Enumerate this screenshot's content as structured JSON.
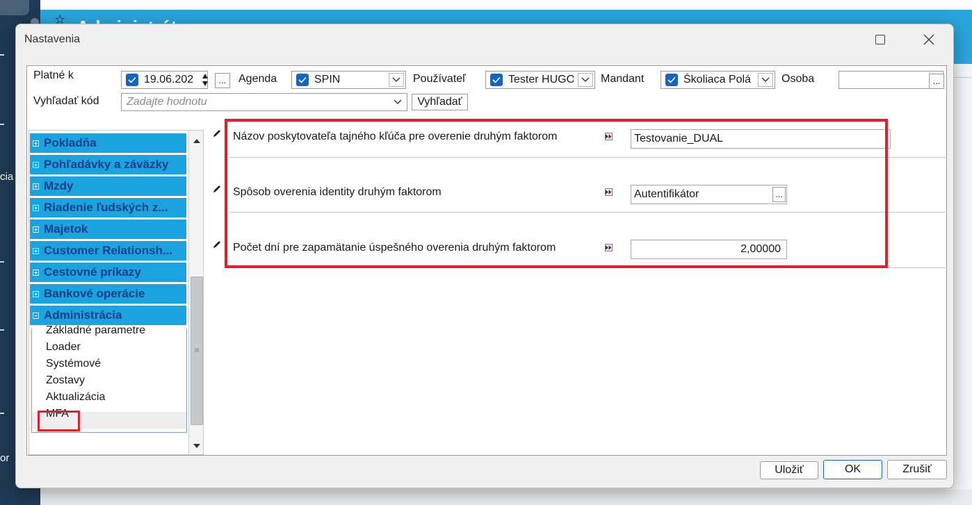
{
  "background": {
    "title": "Administrát",
    "side_labels": [
      "cia",
      "or"
    ]
  },
  "dialog": {
    "title": "Nastavenia",
    "filters": {
      "valid_label": "Platné k",
      "valid_value": "19.06.202",
      "agenda_label": "Agenda",
      "agenda_value": "SPIN",
      "user_label": "Používateľ",
      "user_value": "Tester HUGO",
      "mandant_label": "Mandant",
      "mandant_value": "Školiaca Polá",
      "person_label": "Osoba",
      "person_value": "",
      "search_label": "Vyhľadať kód",
      "search_placeholder": "Zadajte hodnotu",
      "search_button": "Vyhľadať",
      "dots": "..."
    },
    "tree": {
      "categories": [
        {
          "label": "Pokladňa",
          "expanded": false
        },
        {
          "label": "Pohľadávky a záväzky",
          "expanded": false
        },
        {
          "label": "Mzdy",
          "expanded": false
        },
        {
          "label": "Riadenie ľudských z...",
          "expanded": false
        },
        {
          "label": "Majetok",
          "expanded": false
        },
        {
          "label": "Customer Relationsh...",
          "expanded": false
        },
        {
          "label": "Cestovné príkazy",
          "expanded": false
        },
        {
          "label": "Bankové operácie",
          "expanded": false
        },
        {
          "label": "Administrácia",
          "expanded": true
        }
      ],
      "subitems": [
        "Základné parametre",
        "Loader",
        "Systémové",
        "Zostavy",
        "Aktualizácia",
        "MFA"
      ],
      "selected": "MFA"
    },
    "settings": [
      {
        "label": "Názov poskytovateľa tajného kľúča pre overenie druhým faktorom",
        "value": "Testovanie_DUAL"
      },
      {
        "label": "Spôsob overenia identity druhým faktorom",
        "value": "Autentifikátor",
        "button": "..."
      },
      {
        "label": "Počet dní pre zapamätanie úspešného overenia druhým faktorom",
        "value": "2,00000"
      }
    ],
    "buttons": {
      "save": "Uložiť",
      "ok": "OK",
      "cancel": "Zrušiť"
    }
  },
  "colors": {
    "category_bg": "#1aa3df",
    "category_text": "#1b3f8a",
    "highlight": "#e0202c",
    "checkbox": "#1565c0"
  }
}
